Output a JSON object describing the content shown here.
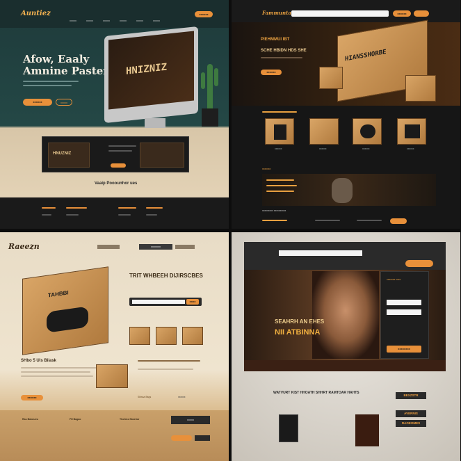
{
  "q1": {
    "logo": "Auntiez",
    "nav": [
      "xxxxx",
      "xxxxx",
      "xxxxx",
      "xxxxx",
      "xxxxx",
      "xxxxx"
    ],
    "cta": "xxxxxx",
    "headline_1": "Afow, Eaaly",
    "headline_2": "Amnine Paster",
    "screen_text": "HNIZNIZ",
    "btn_primary": "xxxxxx",
    "btn_secondary": "xxxxx",
    "banner_title": "HNUZNIZ",
    "section_title": "Vaaip Pooounhor ues"
  },
  "q2": {
    "logo": "Fammuntaa",
    "search_btn": "xxxxxx",
    "hero_title_1": "PIEHMMUI IBT",
    "hero_title_2": "SCHE HBIDN HDS SHE",
    "hero_btn": "xxxxxx",
    "box_label": "HIANSSHORBE",
    "products": [
      "xxxxxx",
      "xxxxxx",
      "xxxxxx",
      "xxxxxx"
    ],
    "mid_title": "xxxxxxx",
    "list_title": "xxxxxxxxx xxxxxxxxxx"
  },
  "q3": {
    "logo": "Raeezn",
    "nav_active": "xxxxxxx",
    "heading": "TRIT WHBEEH DIJIRSCBES",
    "search_btn": "xxxx",
    "subheading": "SHbo 5 Uis Biiask",
    "box_label": "TAHBBI",
    "btn": "xxxxxx",
    "mid_labels": [
      "Shissa Bsgs",
      "xxxxxx"
    ],
    "footer_cols": [
      "Rau Baionzeu",
      "FH Bagao",
      "Thohiss Sbseirar"
    ],
    "footer_btn": "xxxxx"
  },
  "q4": {
    "hero_1": "SEAHRH AN EHES",
    "hero_2": "NII ATBINNA",
    "form_title": "xxxxxxx xxxx",
    "form_btn": "xxxxxxxx",
    "promo": "WATVURT KIST HHOATH SHHRT RAMTOAR HAHTS",
    "side_items": [
      "BEXZSTR",
      "AVERNIS",
      "RAOEOMES"
    ]
  }
}
